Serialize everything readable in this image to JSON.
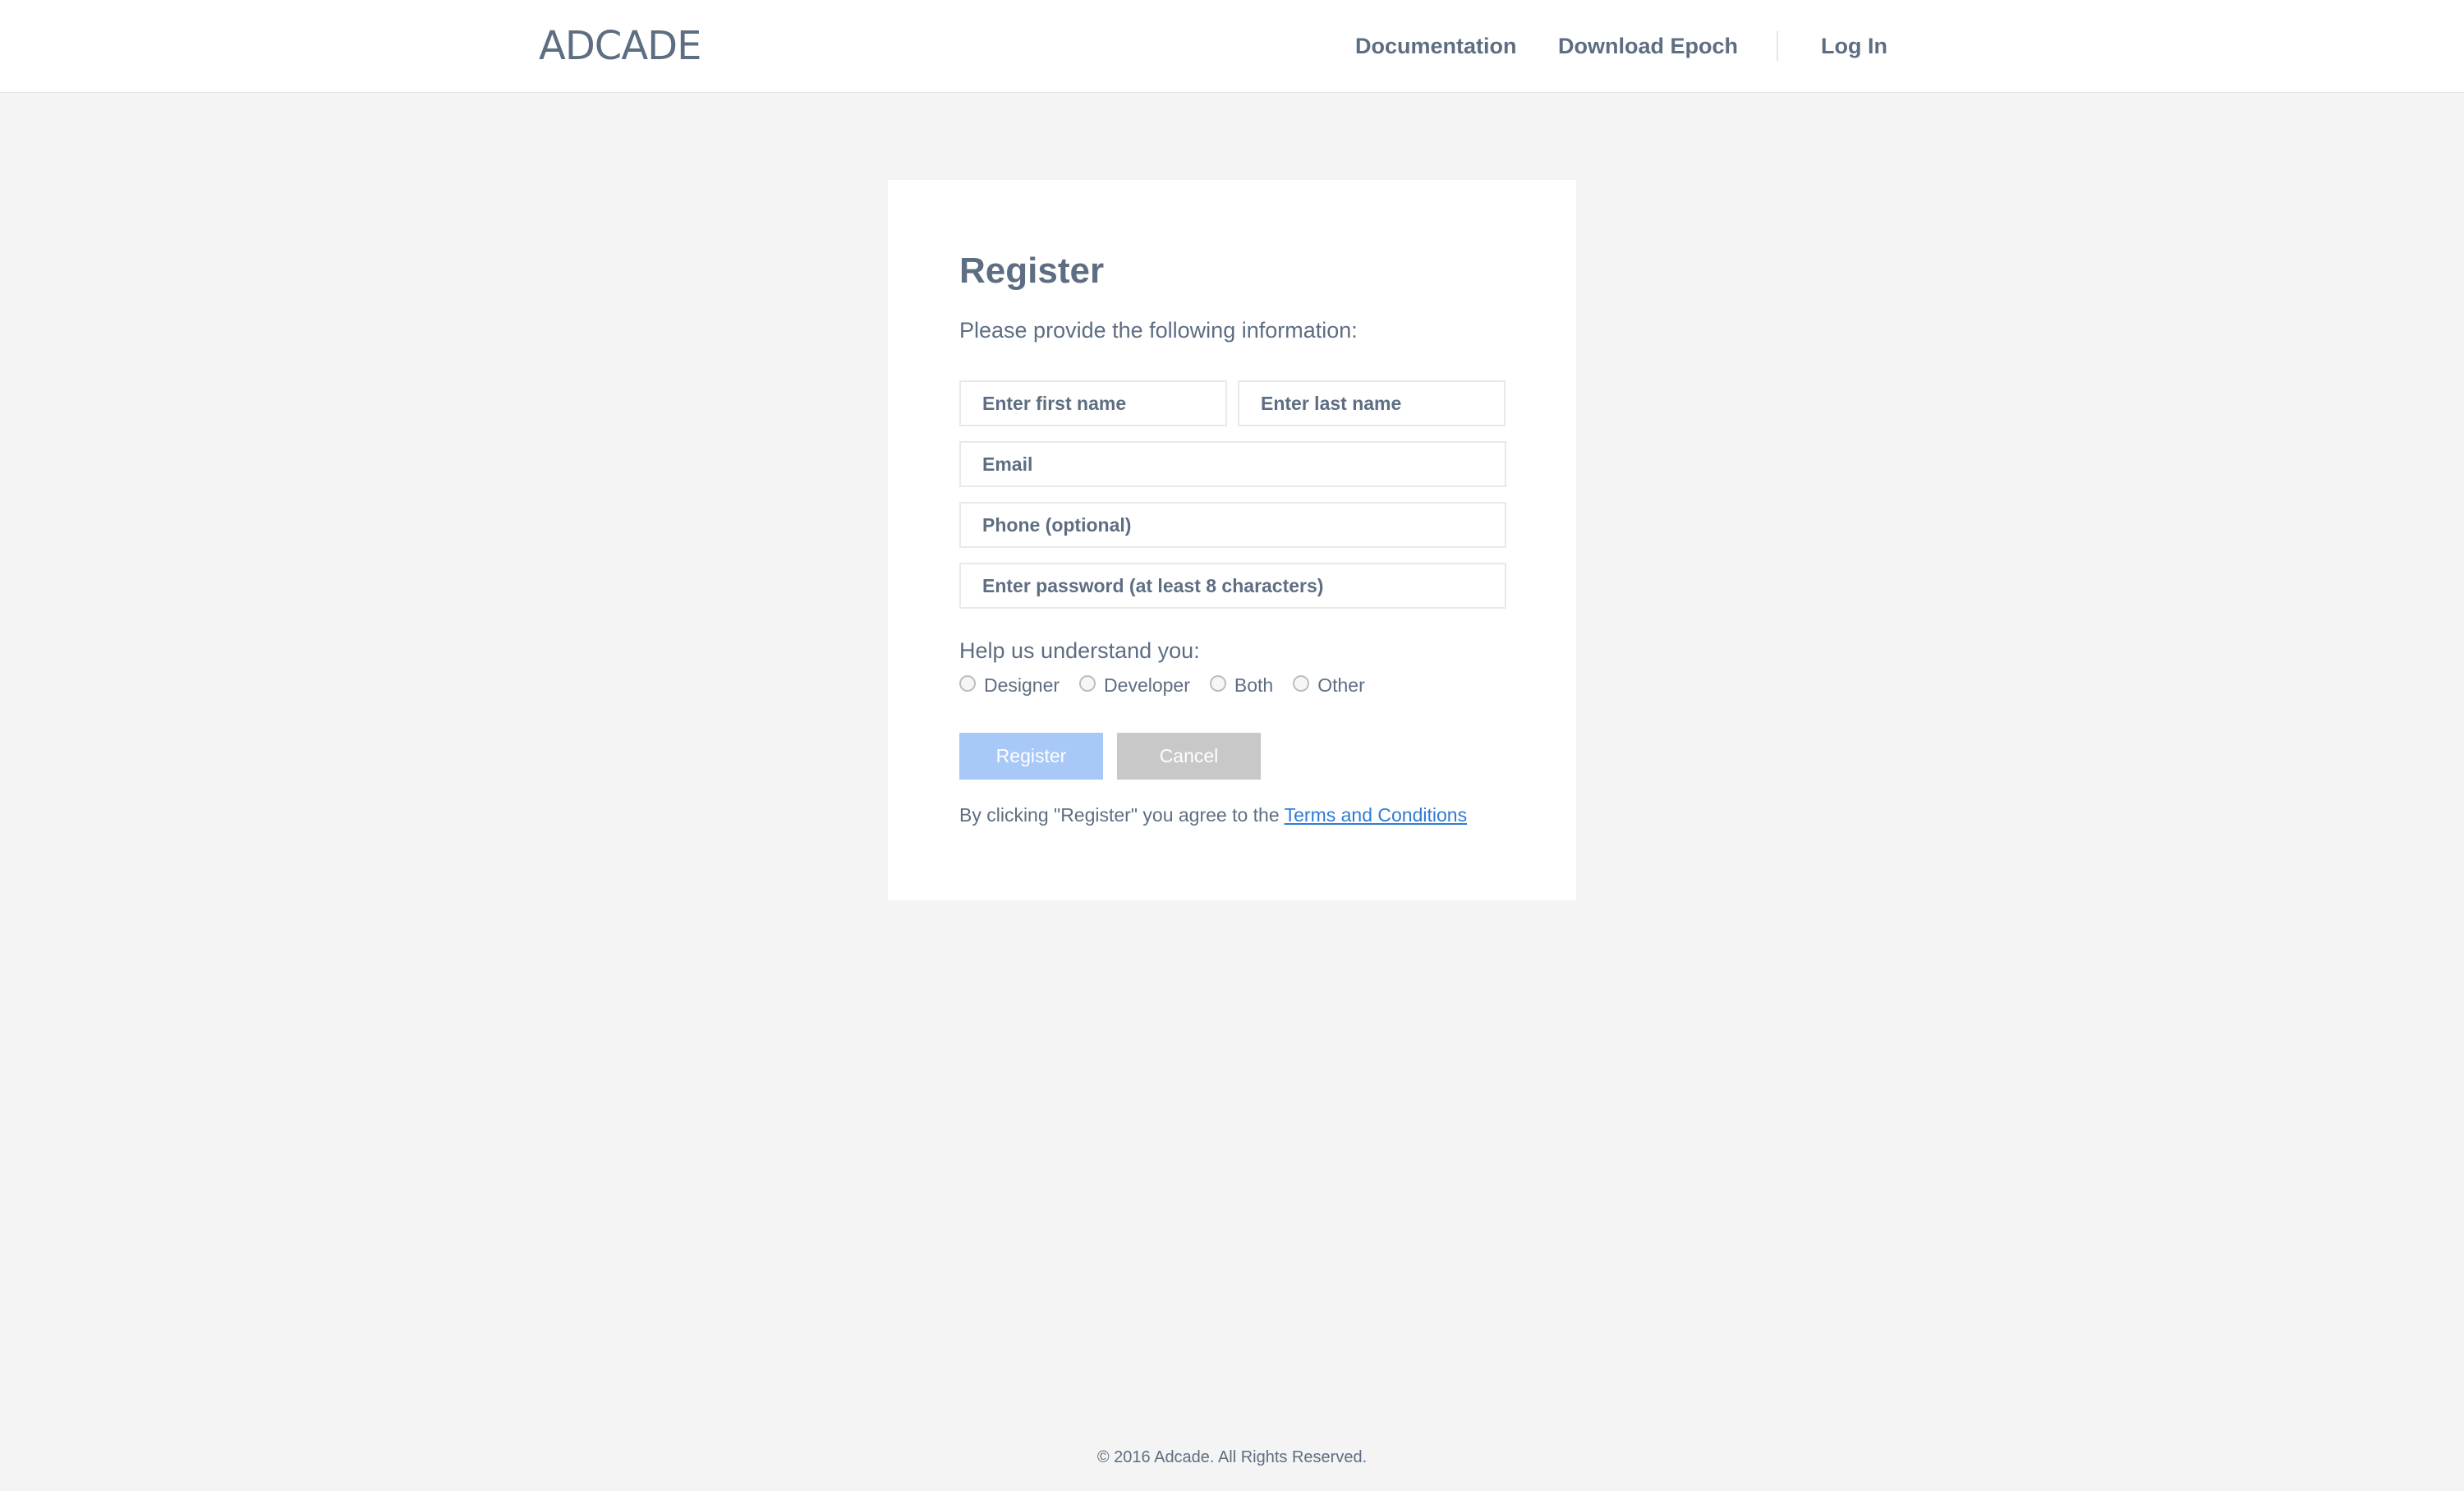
{
  "header": {
    "logo_text": "ADCADE",
    "nav": {
      "documentation": "Documentation",
      "download": "Download Epoch",
      "login": "Log In"
    }
  },
  "form": {
    "title": "Register",
    "subtitle": "Please provide the following information:",
    "fields": {
      "first_name": {
        "placeholder": "Enter first name",
        "value": ""
      },
      "last_name": {
        "placeholder": "Enter last name",
        "value": ""
      },
      "email": {
        "placeholder": "Email",
        "value": ""
      },
      "phone": {
        "placeholder": "Phone (optional)",
        "value": ""
      },
      "password": {
        "placeholder": "Enter password (at least 8 characters)",
        "value": ""
      }
    },
    "help_label": "Help us understand you:",
    "roles": [
      "Designer",
      "Developer",
      "Both",
      "Other"
    ],
    "register_button": "Register",
    "cancel_button": "Cancel",
    "terms_prefix": "By clicking \"Register\" you agree to the",
    "terms_link": "Terms and Conditions"
  },
  "footer": {
    "copyright": "© 2016 Adcade. All Rights Reserved."
  },
  "colors": {
    "background": "#f4f4f4",
    "text": "#5e6e82",
    "link": "#2f7bd6",
    "register_button": "#a8c8f7",
    "cancel_button": "#c8c8c8"
  }
}
